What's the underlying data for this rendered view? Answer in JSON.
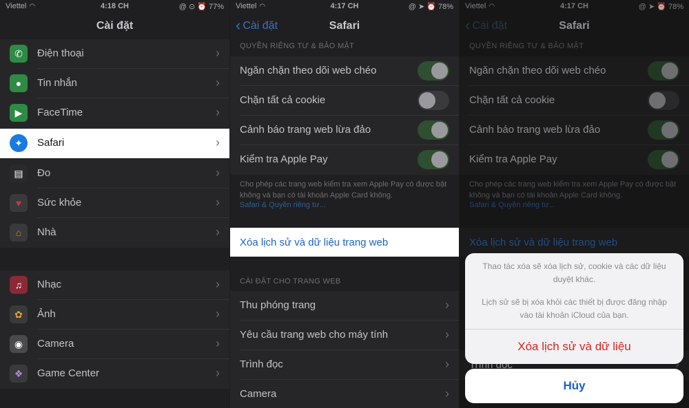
{
  "panel1": {
    "status": {
      "carrier": "Viettel",
      "time": "4:18 CH",
      "right": "@ ⊙ ⏰ 77%"
    },
    "nav_title": "Cài đặt",
    "rows": [
      {
        "label": "Điện thoại",
        "icon": "phone-icon",
        "color": "#2f8a45"
      },
      {
        "label": "Tin nhắn",
        "icon": "messages-icon",
        "color": "#2f8a45"
      },
      {
        "label": "FaceTime",
        "icon": "facetime-icon",
        "color": "#2f8a45"
      },
      {
        "label": "Safari",
        "icon": "safari-icon",
        "color": "#1a7ae0"
      },
      {
        "label": "Đo",
        "icon": "measure-icon",
        "color": "#2a2a2c"
      },
      {
        "label": "Sức khỏe",
        "icon": "health-icon",
        "color": "#3a3a3c"
      },
      {
        "label": "Nhà",
        "icon": "home-icon",
        "color": "#8a6a1e"
      },
      {
        "label": "Nhạc",
        "icon": "music-icon",
        "color": "#8a2a34"
      },
      {
        "label": "Ảnh",
        "icon": "photos-icon",
        "color": "#3a3a3c"
      },
      {
        "label": "Camera",
        "icon": "camera-icon",
        "color": "#4a4a4c"
      },
      {
        "label": "Game Center",
        "icon": "game-center-icon",
        "color": "#3a3a3c"
      }
    ]
  },
  "panel2": {
    "status": {
      "carrier": "Viettel",
      "time": "4:17 CH",
      "right": "@ ➤ ⏰ 78%"
    },
    "nav_title": "Safari",
    "back_label": "Cài đặt",
    "privacy_header": "QUYỀN RIÊNG TƯ & BẢO MẬT",
    "toggles": [
      {
        "label": "Ngăn chặn theo dõi web chéo",
        "on": true
      },
      {
        "label": "Chặn tất cả cookie",
        "on": false
      },
      {
        "label": "Cảnh báo trang web lừa đảo",
        "on": true
      },
      {
        "label": "Kiểm tra Apple Pay",
        "on": true
      }
    ],
    "footer": "Cho phép các trang web kiểm tra xem Apple Pay có được bật không và bạn có tài khoản Apple Card không.",
    "footer_link": "Safari & Quyền riêng tư...",
    "clear_label": "Xóa lịch sử và dữ liệu trang web",
    "web_settings_header": "CÀI ĐẶT CHO TRANG WEB",
    "web_rows": [
      {
        "label": "Thu phóng trang"
      },
      {
        "label": "Yêu cầu trang web cho máy tính"
      },
      {
        "label": "Trình đọc"
      },
      {
        "label": "Camera"
      }
    ]
  },
  "panel3": {
    "status": {
      "carrier": "Viettel",
      "time": "4:17 CH",
      "right": "@ ➤ ⏰ 78%"
    },
    "sheet": {
      "message_1": "Thao tác xóa sẽ xóa lịch sử, cookie và các dữ liệu duyệt khác.",
      "message_2": "Lịch sử sẽ bị xóa khỏi các thiết bị được đăng nhập vào tài khoản iCloud của bạn.",
      "destructive_label": "Xóa lịch sử và dữ liệu",
      "cancel_label": "Hủy"
    },
    "peek_row_label": "Trình đọc"
  }
}
